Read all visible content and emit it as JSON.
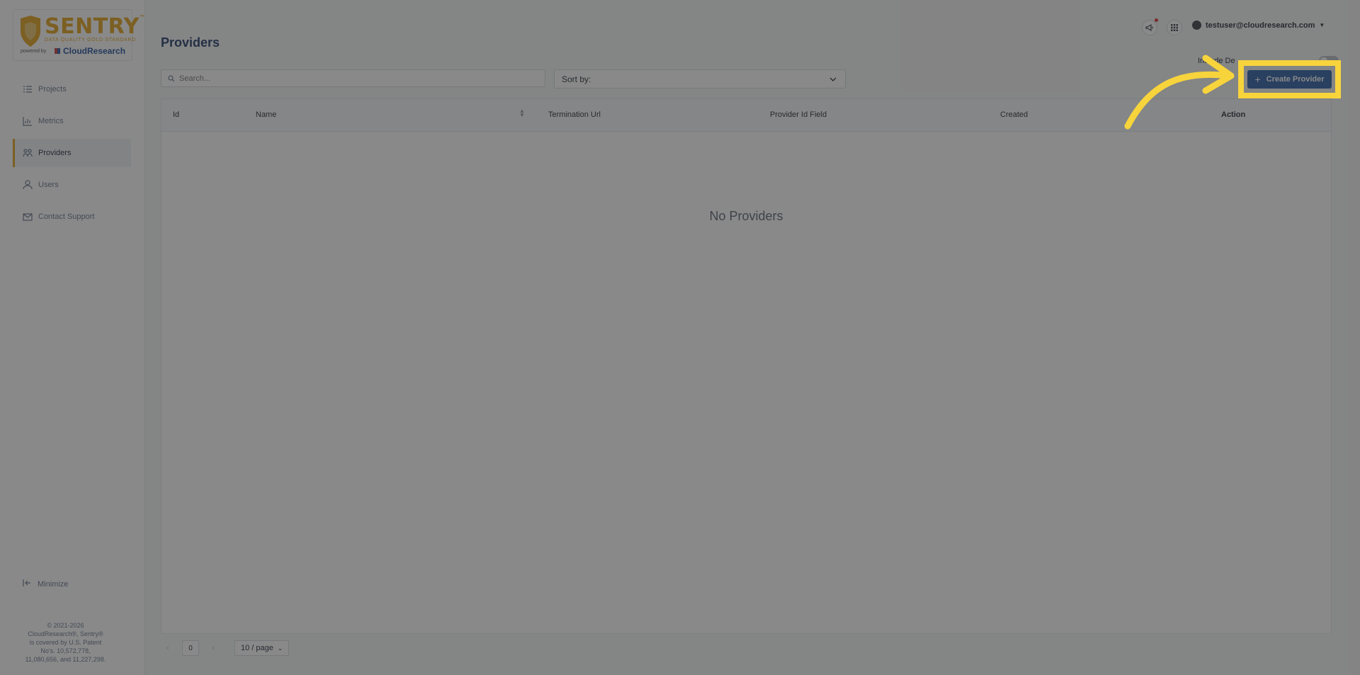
{
  "sidebar": {
    "logo": {
      "brand": "SENTRY",
      "tagline": "DATA QUALITY GOLD STANDARD",
      "powered_by": "powered by",
      "company": "CloudResearch"
    },
    "items": [
      {
        "label": "Projects",
        "icon": "list-icon",
        "active": false
      },
      {
        "label": "Metrics",
        "icon": "chart-icon",
        "active": false
      },
      {
        "label": "Providers",
        "icon": "people-icon",
        "active": true
      },
      {
        "label": "Users",
        "icon": "user-icon",
        "active": false
      },
      {
        "label": "Contact Support",
        "icon": "mail-icon",
        "active": false
      }
    ],
    "minimize_label": "Minimize",
    "copyright": [
      "© 2021-2026",
      "CloudResearch®, Sentry®",
      "is covered by U.S. Patent",
      "No's. 10,572,778,",
      "11,080,656, and 11,227,298."
    ]
  },
  "header": {
    "title": "Providers",
    "user_email": "testuser@cloudresearch.com"
  },
  "toolbar": {
    "search_placeholder": "Search...",
    "sort_label": "Sort by:",
    "include_label": "Include De",
    "create_label": "Create Provider"
  },
  "table": {
    "columns": [
      "Id",
      "Name",
      "Termination Url",
      "Provider Id Field",
      "Created",
      "Action"
    ],
    "empty_text": "No Providers"
  },
  "pagination": {
    "current_page": "0",
    "page_size": "10 / page"
  },
  "colors": {
    "accent": "#e2a31c",
    "primary": "#2b5ea7",
    "highlight": "#f7d43c"
  }
}
